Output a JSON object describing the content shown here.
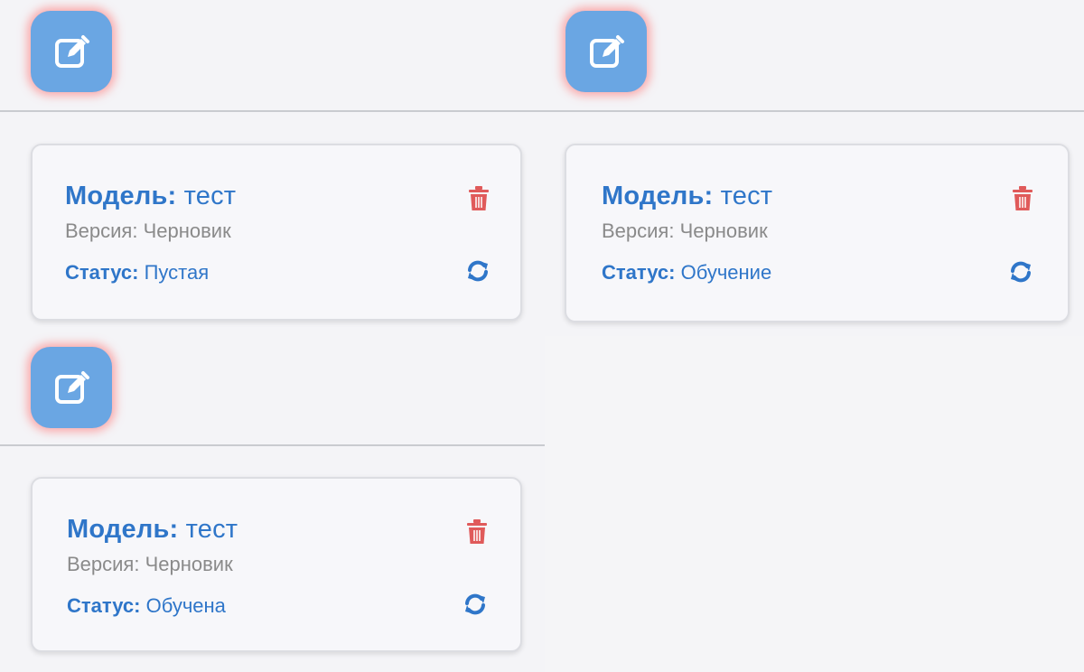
{
  "colors": {
    "accent": "#2f76c9",
    "edit_button": "#6aa6e3",
    "delete_icon": "#e05a5a",
    "muted_text": "#8a8a8a",
    "card_background": "#f7f7fa"
  },
  "panels": [
    {
      "edit_icon": "edit-icon",
      "card": {
        "title_label": "Модель:",
        "title_value": "тест",
        "version_text": "Версия: Черновик",
        "status_label": "Статус:",
        "status_value": "Пустая",
        "delete_icon": "trash-icon",
        "refresh_icon": "refresh-icon"
      }
    },
    {
      "edit_icon": "edit-icon",
      "card": {
        "title_label": "Модель:",
        "title_value": "тест",
        "version_text": "Версия: Черновик",
        "status_label": "Статус:",
        "status_value": "Обучение",
        "delete_icon": "trash-icon",
        "refresh_icon": "refresh-icon"
      }
    },
    {
      "edit_icon": "edit-icon",
      "card": {
        "title_label": "Модель:",
        "title_value": "тест",
        "version_text": "Версия: Черновик",
        "status_label": "Статус:",
        "status_value": "Обучена",
        "delete_icon": "trash-icon",
        "refresh_icon": "refresh-icon"
      }
    }
  ]
}
